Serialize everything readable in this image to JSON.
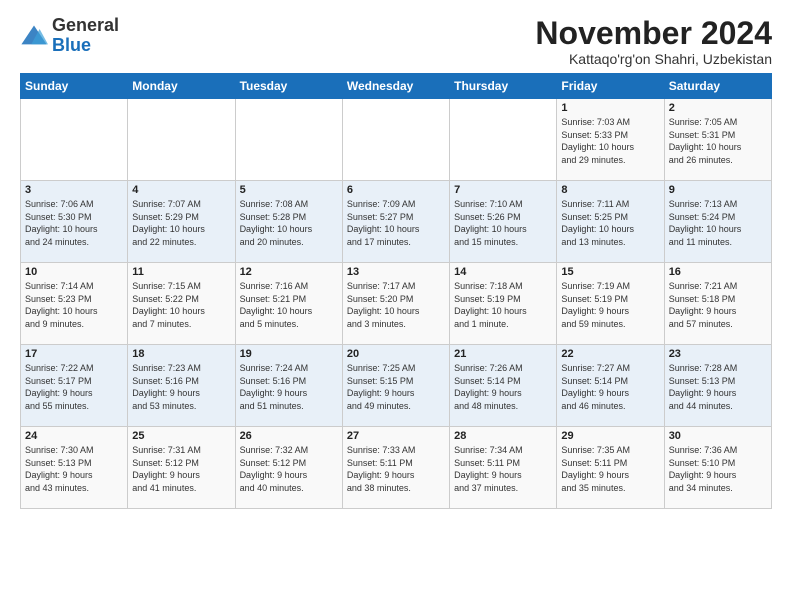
{
  "logo": {
    "general": "General",
    "blue": "Blue"
  },
  "title": "November 2024",
  "subtitle": "Kattaqo'rg'on Shahri, Uzbekistan",
  "headers": [
    "Sunday",
    "Monday",
    "Tuesday",
    "Wednesday",
    "Thursday",
    "Friday",
    "Saturday"
  ],
  "weeks": [
    [
      {
        "day": "",
        "info": ""
      },
      {
        "day": "",
        "info": ""
      },
      {
        "day": "",
        "info": ""
      },
      {
        "day": "",
        "info": ""
      },
      {
        "day": "",
        "info": ""
      },
      {
        "day": "1",
        "info": "Sunrise: 7:03 AM\nSunset: 5:33 PM\nDaylight: 10 hours\nand 29 minutes."
      },
      {
        "day": "2",
        "info": "Sunrise: 7:05 AM\nSunset: 5:31 PM\nDaylight: 10 hours\nand 26 minutes."
      }
    ],
    [
      {
        "day": "3",
        "info": "Sunrise: 7:06 AM\nSunset: 5:30 PM\nDaylight: 10 hours\nand 24 minutes."
      },
      {
        "day": "4",
        "info": "Sunrise: 7:07 AM\nSunset: 5:29 PM\nDaylight: 10 hours\nand 22 minutes."
      },
      {
        "day": "5",
        "info": "Sunrise: 7:08 AM\nSunset: 5:28 PM\nDaylight: 10 hours\nand 20 minutes."
      },
      {
        "day": "6",
        "info": "Sunrise: 7:09 AM\nSunset: 5:27 PM\nDaylight: 10 hours\nand 17 minutes."
      },
      {
        "day": "7",
        "info": "Sunrise: 7:10 AM\nSunset: 5:26 PM\nDaylight: 10 hours\nand 15 minutes."
      },
      {
        "day": "8",
        "info": "Sunrise: 7:11 AM\nSunset: 5:25 PM\nDaylight: 10 hours\nand 13 minutes."
      },
      {
        "day": "9",
        "info": "Sunrise: 7:13 AM\nSunset: 5:24 PM\nDaylight: 10 hours\nand 11 minutes."
      }
    ],
    [
      {
        "day": "10",
        "info": "Sunrise: 7:14 AM\nSunset: 5:23 PM\nDaylight: 10 hours\nand 9 minutes."
      },
      {
        "day": "11",
        "info": "Sunrise: 7:15 AM\nSunset: 5:22 PM\nDaylight: 10 hours\nand 7 minutes."
      },
      {
        "day": "12",
        "info": "Sunrise: 7:16 AM\nSunset: 5:21 PM\nDaylight: 10 hours\nand 5 minutes."
      },
      {
        "day": "13",
        "info": "Sunrise: 7:17 AM\nSunset: 5:20 PM\nDaylight: 10 hours\nand 3 minutes."
      },
      {
        "day": "14",
        "info": "Sunrise: 7:18 AM\nSunset: 5:19 PM\nDaylight: 10 hours\nand 1 minute."
      },
      {
        "day": "15",
        "info": "Sunrise: 7:19 AM\nSunset: 5:19 PM\nDaylight: 9 hours\nand 59 minutes."
      },
      {
        "day": "16",
        "info": "Sunrise: 7:21 AM\nSunset: 5:18 PM\nDaylight: 9 hours\nand 57 minutes."
      }
    ],
    [
      {
        "day": "17",
        "info": "Sunrise: 7:22 AM\nSunset: 5:17 PM\nDaylight: 9 hours\nand 55 minutes."
      },
      {
        "day": "18",
        "info": "Sunrise: 7:23 AM\nSunset: 5:16 PM\nDaylight: 9 hours\nand 53 minutes."
      },
      {
        "day": "19",
        "info": "Sunrise: 7:24 AM\nSunset: 5:16 PM\nDaylight: 9 hours\nand 51 minutes."
      },
      {
        "day": "20",
        "info": "Sunrise: 7:25 AM\nSunset: 5:15 PM\nDaylight: 9 hours\nand 49 minutes."
      },
      {
        "day": "21",
        "info": "Sunrise: 7:26 AM\nSunset: 5:14 PM\nDaylight: 9 hours\nand 48 minutes."
      },
      {
        "day": "22",
        "info": "Sunrise: 7:27 AM\nSunset: 5:14 PM\nDaylight: 9 hours\nand 46 minutes."
      },
      {
        "day": "23",
        "info": "Sunrise: 7:28 AM\nSunset: 5:13 PM\nDaylight: 9 hours\nand 44 minutes."
      }
    ],
    [
      {
        "day": "24",
        "info": "Sunrise: 7:30 AM\nSunset: 5:13 PM\nDaylight: 9 hours\nand 43 minutes."
      },
      {
        "day": "25",
        "info": "Sunrise: 7:31 AM\nSunset: 5:12 PM\nDaylight: 9 hours\nand 41 minutes."
      },
      {
        "day": "26",
        "info": "Sunrise: 7:32 AM\nSunset: 5:12 PM\nDaylight: 9 hours\nand 40 minutes."
      },
      {
        "day": "27",
        "info": "Sunrise: 7:33 AM\nSunset: 5:11 PM\nDaylight: 9 hours\nand 38 minutes."
      },
      {
        "day": "28",
        "info": "Sunrise: 7:34 AM\nSunset: 5:11 PM\nDaylight: 9 hours\nand 37 minutes."
      },
      {
        "day": "29",
        "info": "Sunrise: 7:35 AM\nSunset: 5:11 PM\nDaylight: 9 hours\nand 35 minutes."
      },
      {
        "day": "30",
        "info": "Sunrise: 7:36 AM\nSunset: 5:10 PM\nDaylight: 9 hours\nand 34 minutes."
      }
    ]
  ]
}
